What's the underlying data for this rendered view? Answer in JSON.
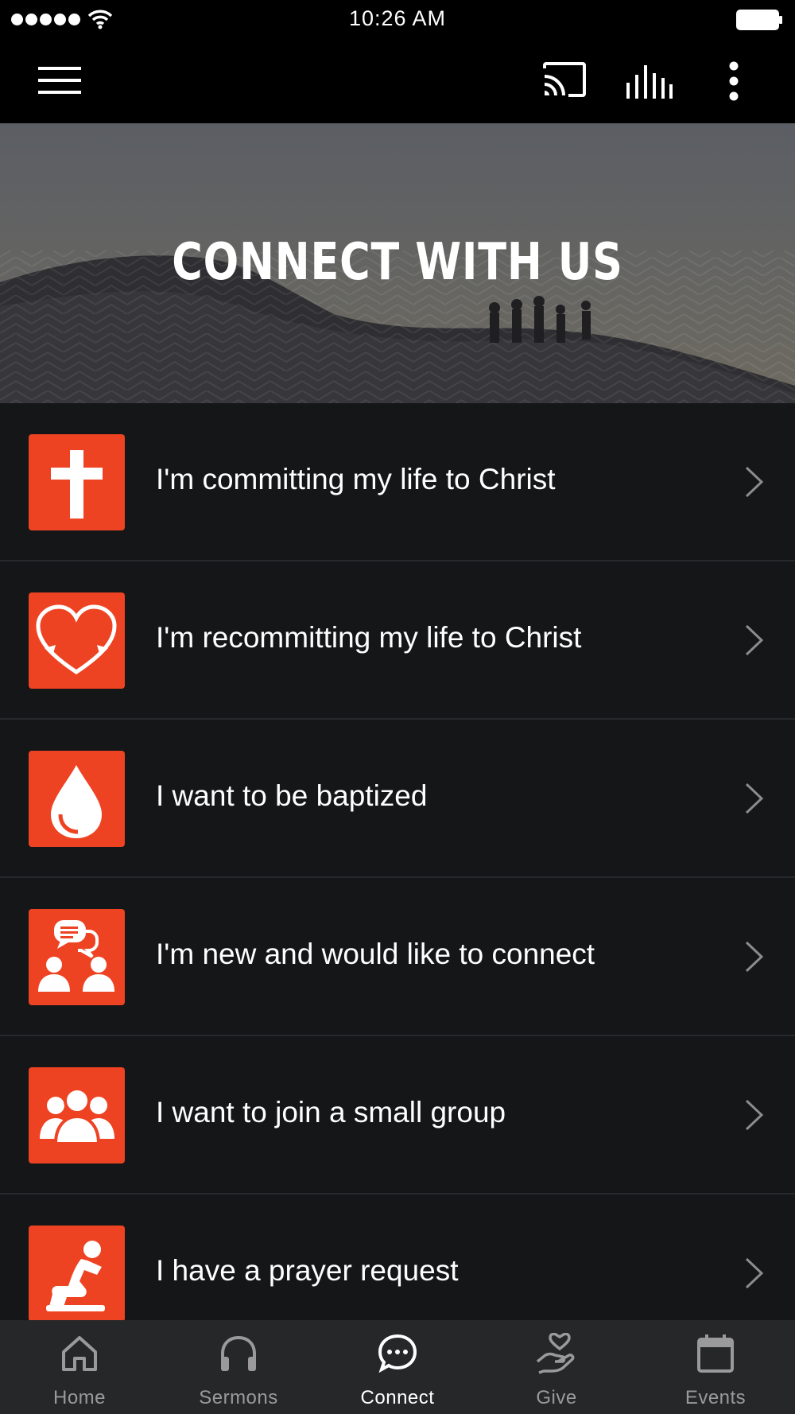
{
  "status_bar": {
    "time": "10:26 AM",
    "signal_icon": "signal-dots-icon",
    "wifi_icon": "wifi-icon",
    "battery_icon": "battery-icon"
  },
  "toolbar": {
    "menu_icon": "hamburger-menu-icon",
    "cast_icon": "cast-icon",
    "audio_icon": "audio-bars-icon",
    "more_icon": "more-vertical-icon"
  },
  "hero": {
    "title": "CONNECT WITH US"
  },
  "colors": {
    "accent": "#ee4323",
    "background": "#151618",
    "tab_bar": "#262729",
    "tab_inactive": "#9a9a9c"
  },
  "list": [
    {
      "label": "I'm committing my life to Christ",
      "icon": "cross-icon"
    },
    {
      "label": "I'm recommitting my life to Christ",
      "icon": "heart-cycle-icon"
    },
    {
      "label": "I want to be baptized",
      "icon": "water-drop-icon"
    },
    {
      "label": "I'm new and would like to connect",
      "icon": "people-chat-icon"
    },
    {
      "label": "I want to join a small group",
      "icon": "group-icon"
    },
    {
      "label": "I have a prayer request",
      "icon": "praying-person-icon"
    }
  ],
  "tabs": [
    {
      "label": "Home",
      "icon": "home-icon",
      "active": false
    },
    {
      "label": "Sermons",
      "icon": "headphones-icon",
      "active": false
    },
    {
      "label": "Connect",
      "icon": "chat-bubble-icon",
      "active": true
    },
    {
      "label": "Give",
      "icon": "hand-heart-icon",
      "active": false
    },
    {
      "label": "Events",
      "icon": "calendar-icon",
      "active": false
    }
  ]
}
